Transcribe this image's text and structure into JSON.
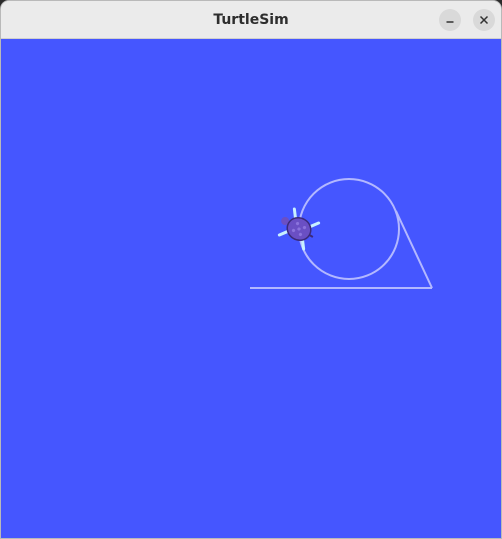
{
  "window": {
    "title": "TurtleSim",
    "buttons": [
      {
        "name": "minimize",
        "icon": "minimize-icon"
      },
      {
        "name": "close",
        "icon": "close-icon"
      }
    ]
  },
  "canvas": {
    "background_color": "#4556ff",
    "pen_color": "#b3b8ff"
  },
  "turtle": {
    "icon": "turtle-icon",
    "shell_color": "#6a4fc4",
    "limb_color": "#c8f0ff"
  }
}
